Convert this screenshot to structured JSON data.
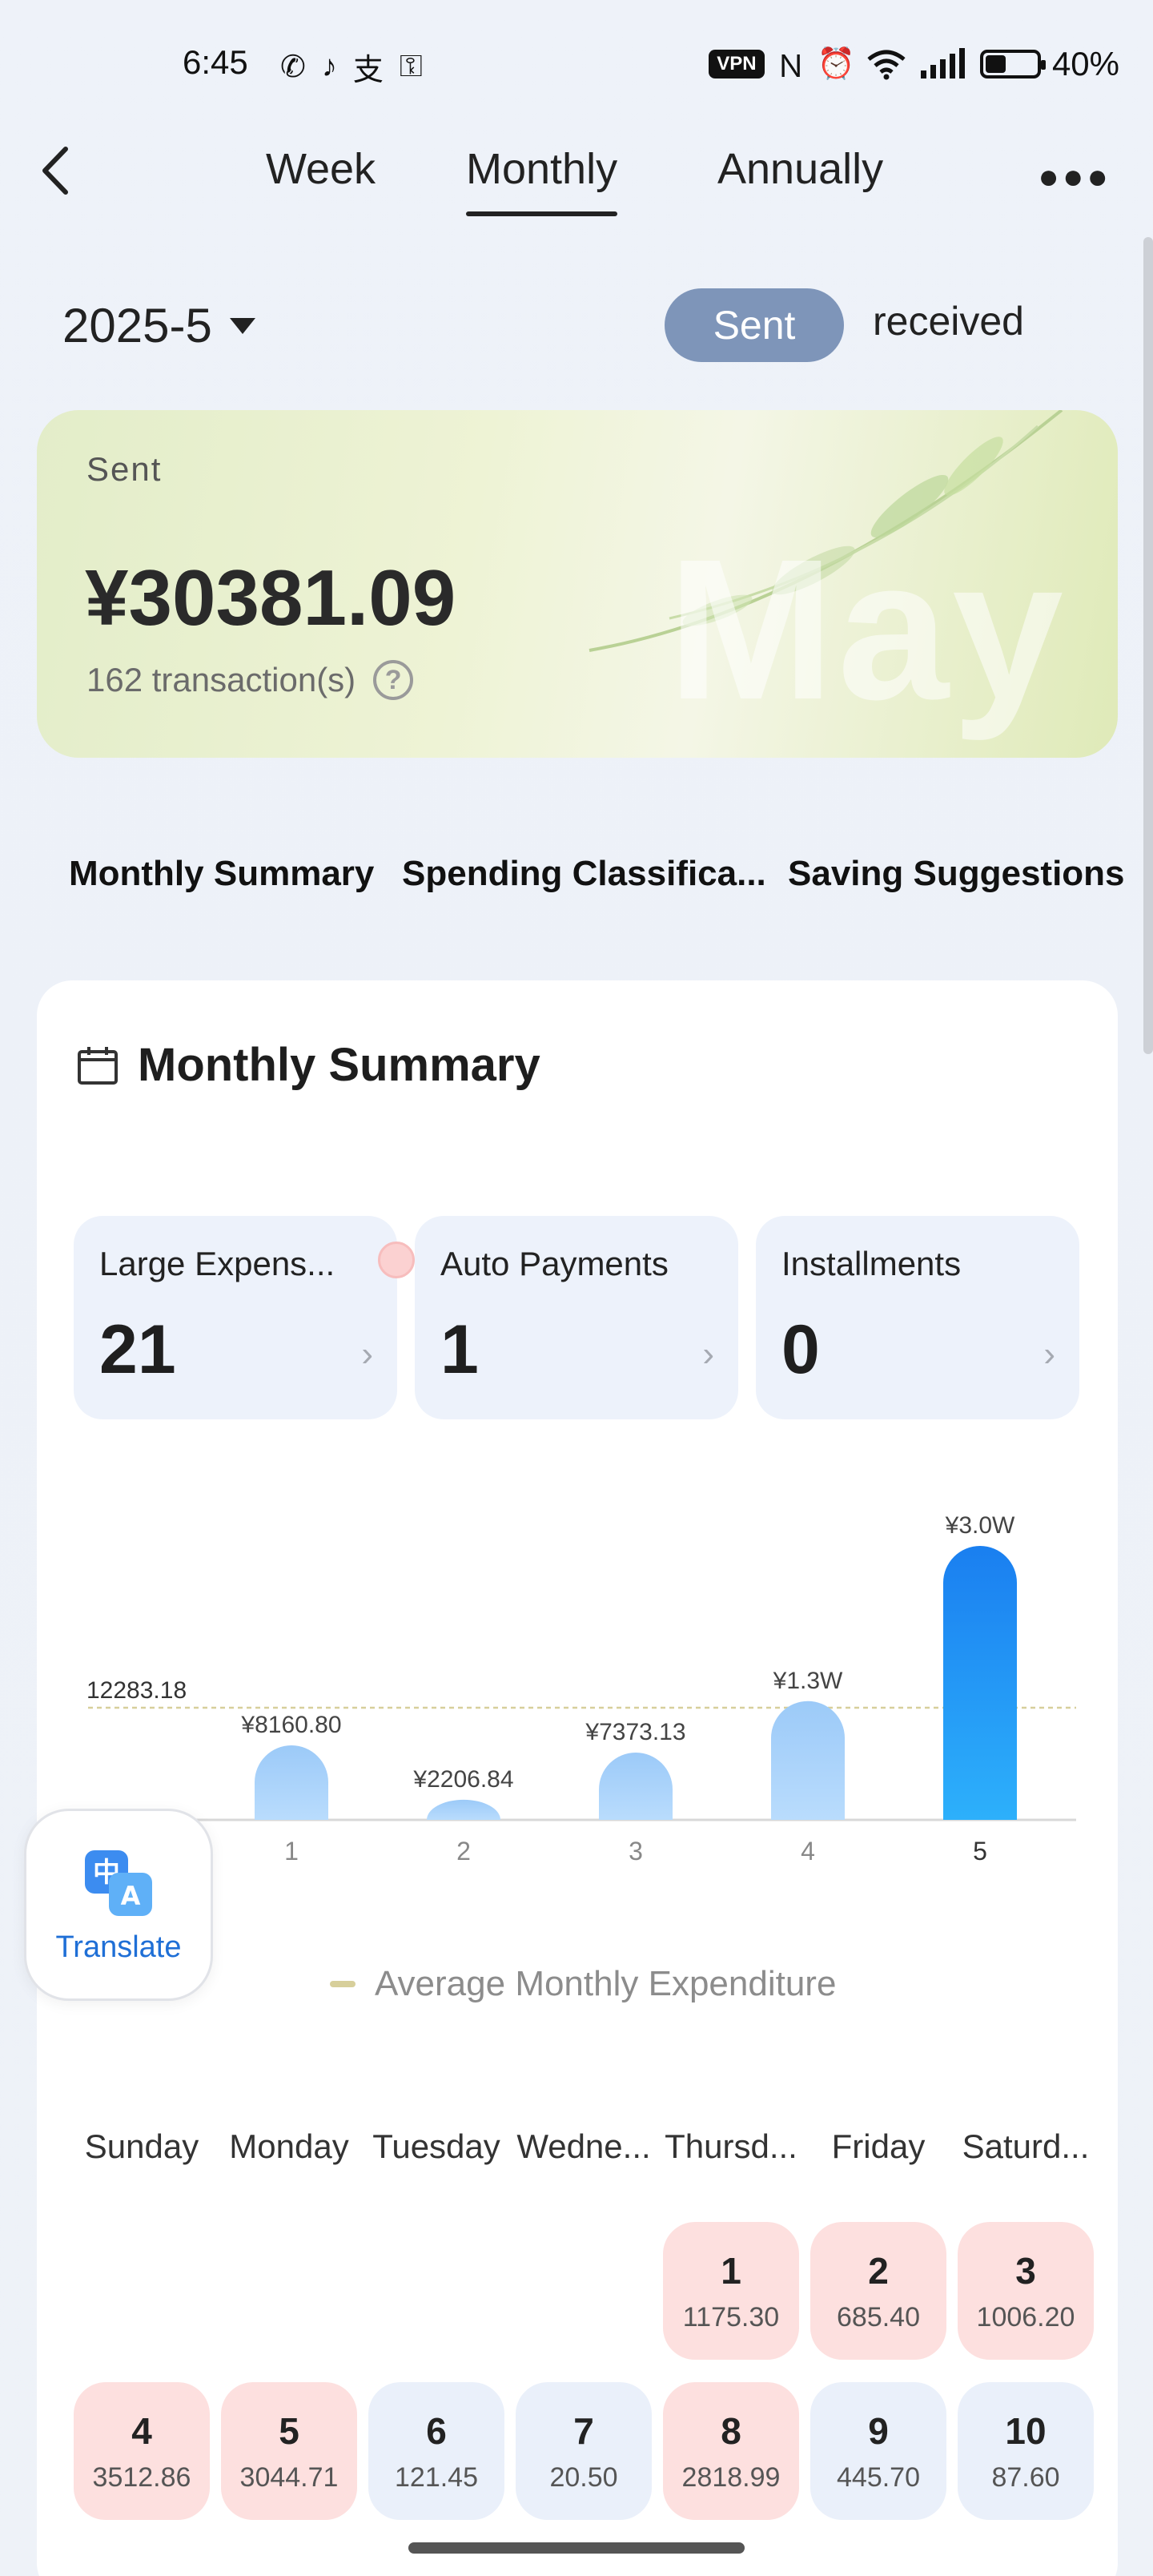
{
  "status_bar": {
    "time": "6:45",
    "left_icons": [
      "whatsapp-icon",
      "tiktok-icon",
      "alipay-icon",
      "key-icon"
    ],
    "vpn": "VPN",
    "battery_percent": "40%",
    "battery_level": 0.4
  },
  "nav": {
    "tabs": [
      {
        "label": "Week",
        "active": false
      },
      {
        "label": "Monthly",
        "active": true
      },
      {
        "label": "Annually",
        "active": false
      }
    ]
  },
  "period": {
    "label": "2025-5",
    "toggle_sent": "Sent",
    "toggle_received": "received"
  },
  "hero": {
    "label": "Sent",
    "amount": "¥30381.09",
    "transactions": "162 transaction(s)",
    "watermark": "May"
  },
  "section_tabs": [
    "Monthly Summary",
    "Spending Classifica...",
    "Saving Suggestions"
  ],
  "summary": {
    "title": "Monthly Summary",
    "stats": [
      {
        "label": "Large Expens...",
        "value": "21"
      },
      {
        "label": "Auto Payments",
        "value": "1"
      },
      {
        "label": "Installments",
        "value": "0"
      }
    ]
  },
  "chart_data": {
    "type": "bar",
    "categories": [
      "1",
      "2",
      "3",
      "4",
      "5"
    ],
    "values": [
      8160.8,
      2206.84,
      7373.13,
      13000,
      30000
    ],
    "data_labels": [
      "¥8160.80",
      "¥2206.84",
      "¥7373.13",
      "¥1.3W",
      "¥3.0W"
    ],
    "average": 12283.18,
    "average_label": "12283.18",
    "legend": "Average Monthly Expenditure",
    "ylim": [
      0,
      30000
    ],
    "colors": {
      "light": "#a8d1fb",
      "strong_top": "#1a7ff0",
      "strong_bottom": "#2db0fb",
      "average": "#d7cf9b"
    }
  },
  "translate": {
    "label": "Translate"
  },
  "calendar": {
    "weekdays": [
      "Sunday",
      "Monday",
      "Tuesday",
      "Wedne...",
      "Thursd...",
      "Friday",
      "Saturd..."
    ],
    "days": [
      {
        "day": "1",
        "amount": "1175.30",
        "level": "high"
      },
      {
        "day": "2",
        "amount": "685.40",
        "level": "high"
      },
      {
        "day": "3",
        "amount": "1006.20",
        "level": "high"
      },
      {
        "day": "4",
        "amount": "3512.86",
        "level": "high"
      },
      {
        "day": "5",
        "amount": "3044.71",
        "level": "high"
      },
      {
        "day": "6",
        "amount": "121.45",
        "level": "low"
      },
      {
        "day": "7",
        "amount": "20.50",
        "level": "low"
      },
      {
        "day": "8",
        "amount": "2818.99",
        "level": "high"
      },
      {
        "day": "9",
        "amount": "445.70",
        "level": "low"
      },
      {
        "day": "10",
        "amount": "87.60",
        "level": "low"
      }
    ]
  }
}
